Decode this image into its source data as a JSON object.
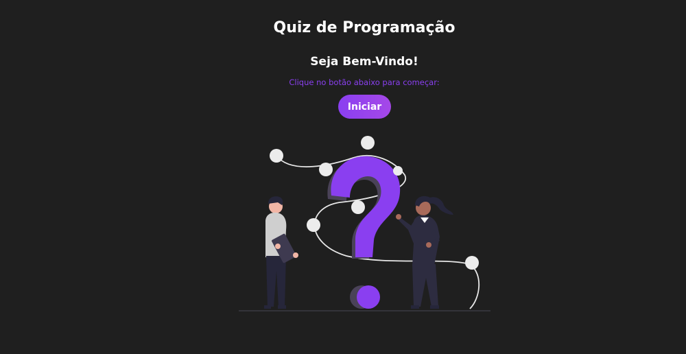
{
  "header": {
    "title": "Quiz de Programação"
  },
  "welcome": {
    "heading": "Seja Bem-Vindo!",
    "hint": "Clique no botão abaixo para começar:"
  },
  "actions": {
    "start_label": "Iniciar"
  },
  "colors": {
    "background": "#1f1f1f",
    "accent": "#8a3ff0",
    "accent_light": "#a548e8",
    "text": "#ffffff"
  },
  "illustration": {
    "icon": "question-mark-people-illustration"
  }
}
